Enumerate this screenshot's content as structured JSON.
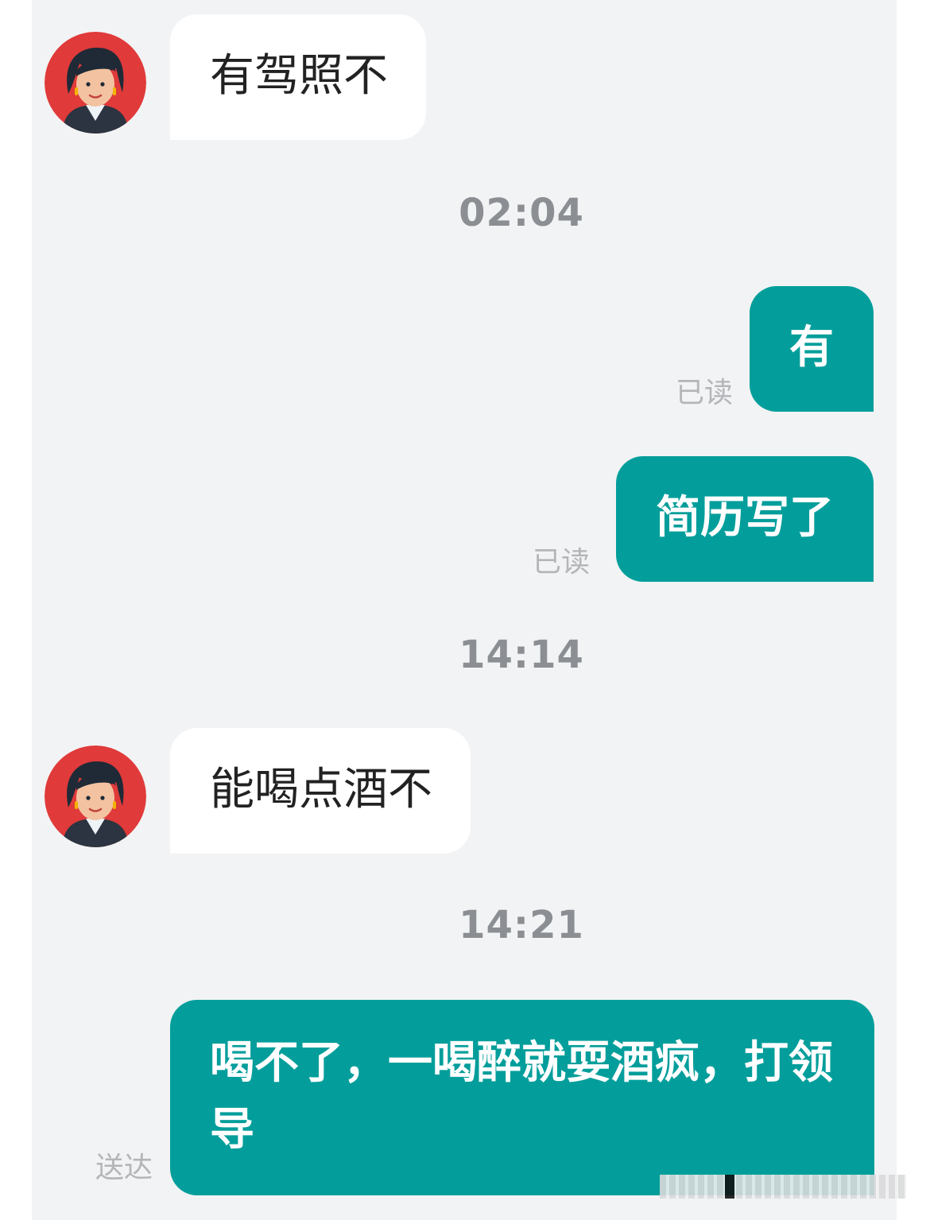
{
  "theme": {
    "panel_background": "#f2f3f4",
    "incoming_bubble": "#ffffff",
    "outgoing_bubble": "#039e9b",
    "avatar_background": "#e03a3a"
  },
  "messages": [
    {
      "direction": "incoming",
      "text": "有驾照不",
      "avatar": "woman-avatar"
    },
    {
      "type": "timestamp",
      "text": "02:04"
    },
    {
      "direction": "outgoing",
      "text": "有",
      "status": "已读"
    },
    {
      "direction": "outgoing",
      "text": "简历写了",
      "status": "已读"
    },
    {
      "type": "timestamp",
      "text": "14:14"
    },
    {
      "direction": "incoming",
      "text": "能喝点酒不",
      "avatar": "woman-avatar"
    },
    {
      "type": "timestamp",
      "text": "14:21"
    },
    {
      "direction": "outgoing",
      "text": "喝不了，一喝醉就耍酒疯，打领导",
      "status": "送达"
    }
  ]
}
